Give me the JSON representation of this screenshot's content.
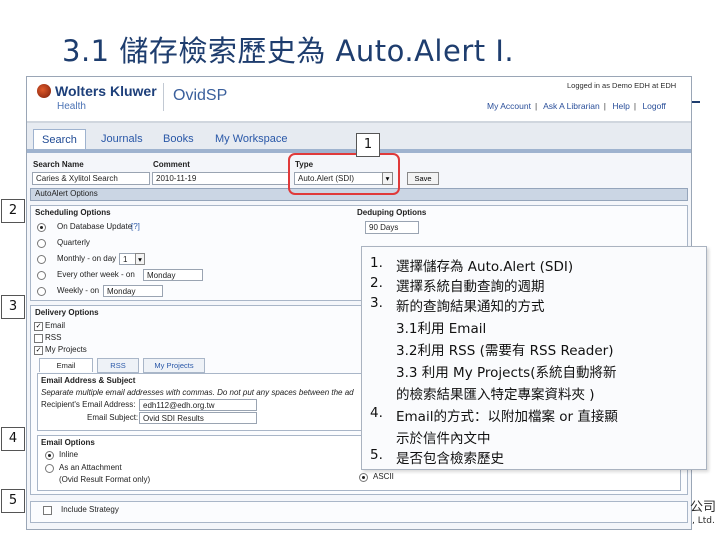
{
  "slide": {
    "title": "3.1 儲存檢索歷史為 Auto.Alert I."
  },
  "header": {
    "brand": "Wolters Kluwer",
    "brand_sub": "Health",
    "product": "OvidSP",
    "logged_in": "Logged in as Demo EDH at EDH",
    "links": [
      "My Account",
      "Ask A Librarian",
      "Help",
      "Logoff"
    ]
  },
  "tabs": [
    {
      "label": "Search"
    },
    {
      "label": "Journals"
    },
    {
      "label": "Books"
    },
    {
      "label": "My Workspace"
    }
  ],
  "form": {
    "search_name_label": "Search Name",
    "search_name_value": "Caries & Xylitol Search",
    "comment_label": "Comment",
    "comment_value": "2010-11-19",
    "type_label": "Type",
    "type_value": "Auto.Alert (SDI)",
    "save_label": "Save",
    "autoalert_options": "AutoAlert Options"
  },
  "scheduling": {
    "title": "Scheduling Options",
    "on_db_update": "On Database Update",
    "help_mark": "[?]",
    "quarterly": "Quarterly",
    "monthly": "Monthly - on day",
    "monthly_day": "1",
    "every_other_week": "Every other week - on",
    "every_other_week_day": "Monday",
    "weekly": "Weekly - on",
    "weekly_day": "Monday"
  },
  "deduping": {
    "title": "Deduping Options",
    "value": "90 Days"
  },
  "delivery": {
    "title": "Delivery Options",
    "email": "Email",
    "rss": "RSS",
    "my_projects": "My Projects",
    "subtabs": [
      "Email",
      "RSS",
      "My Projects"
    ]
  },
  "email_address": {
    "title": "Email Address & Subject",
    "warning": "Separate multiple email addresses with commas. Do not put any spaces between the ad",
    "recipient_label": "Recipient's Email Address:",
    "recipient_value": "edh112@edh.org.tw",
    "subject_label": "Email Subject:",
    "subject_value": "Ovid SDI Results"
  },
  "email_options": {
    "title": "Email Options",
    "inline": "Inline",
    "attachment": "As an Attachment",
    "attachment_note": "(Ovid Result Format only)",
    "right_fragment": "ASCII"
  },
  "include_strategy": "Include Strategy",
  "badges": [
    "1",
    "2",
    "3",
    "4",
    "5"
  ],
  "notes": [
    {
      "n": "1.",
      "text": "選擇儲存為 Auto.Alert (SDI)"
    },
    {
      "n": "2.",
      "text": "選擇系統自動查詢的週期"
    },
    {
      "n": "3.",
      "text": "新的查詢結果通知的方式"
    },
    {
      "n": "",
      "text": "3.1利用 Email"
    },
    {
      "n": "",
      "text": "3.2利用 RSS (需要有 RSS Reader)"
    },
    {
      "n": "",
      "text": "3.3 利用 My Projects(系統自動將新"
    },
    {
      "n": "",
      "text": "的檢索結果匯入特定專案資料夾 )"
    },
    {
      "n": "4.",
      "text": "Email的方式：以附加檔案 or 直接顯"
    },
    {
      "n": "",
      "text": "示於信件內文中"
    },
    {
      "n": "5.",
      "text": "是否包含檢索歷史"
    }
  ],
  "footer_fragment": "公司",
  "footer_fragment2": ", Ltd."
}
